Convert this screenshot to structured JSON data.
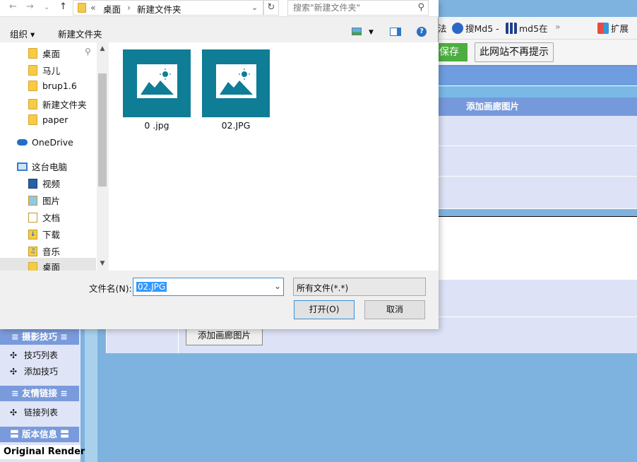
{
  "dialog": {
    "address": {
      "prefix": "«",
      "location": "桌面",
      "folder": "新建文件夹"
    },
    "search": {
      "placeholder": "搜索\"新建文件夹\""
    },
    "commands": {
      "organize": "组织 ▾",
      "new_folder": "新建文件夹"
    },
    "nav": {
      "items": [
        {
          "label": "桌面",
          "icon": "folder-icon"
        },
        {
          "label": "马儿",
          "icon": "folder-icon"
        },
        {
          "label": "brup1.6",
          "icon": "folder-icon"
        },
        {
          "label": "新建文件夹",
          "icon": "folder-icon"
        },
        {
          "label": "paper",
          "icon": "folder-icon"
        },
        {
          "label": "OneDrive",
          "icon": "cloud-icon"
        },
        {
          "label": "这台电脑",
          "icon": "computer-icon"
        },
        {
          "label": "视频",
          "icon": "video-icon"
        },
        {
          "label": "图片",
          "icon": "pictures-icon"
        },
        {
          "label": "文档",
          "icon": "documents-icon"
        },
        {
          "label": "下载",
          "icon": "download-icon"
        },
        {
          "label": "音乐",
          "icon": "music-icon"
        },
        {
          "label": "桌面",
          "icon": "folder-icon"
        }
      ]
    },
    "files": [
      {
        "name": "0 .jpg"
      },
      {
        "name": "02.JPG"
      }
    ],
    "filename": {
      "label": "文件名(N):",
      "value": "02.JPG"
    },
    "filetype": {
      "value": "所有文件(*.*)"
    },
    "buttons": {
      "open": "打开(O)",
      "cancel": "取消"
    }
  },
  "browser": {
    "bookmarks": [
      "法",
      "搜Md5 -",
      "md5在",
      "»",
      "扩展"
    ],
    "save_button": "保存",
    "no_prompt_button": "此网站不再提示"
  },
  "admin": {
    "section_header": "添加画廊图片",
    "add_image_button": "添加画廊图片",
    "sidebar": {
      "groups": [
        {
          "title": "≡ 摄影技巧 ≡",
          "items": [
            "技巧列表",
            "添加技巧"
          ]
        },
        {
          "title": "≡ 友情链接 ≡",
          "items": [
            "链接列表"
          ]
        },
        {
          "title": "〓 版本信息 〓",
          "items": []
        }
      ],
      "footer": "Original Render"
    }
  },
  "colors": {
    "accent": "#0f7d96",
    "header_blue": "#7699dc",
    "selection": "#3399ff"
  }
}
